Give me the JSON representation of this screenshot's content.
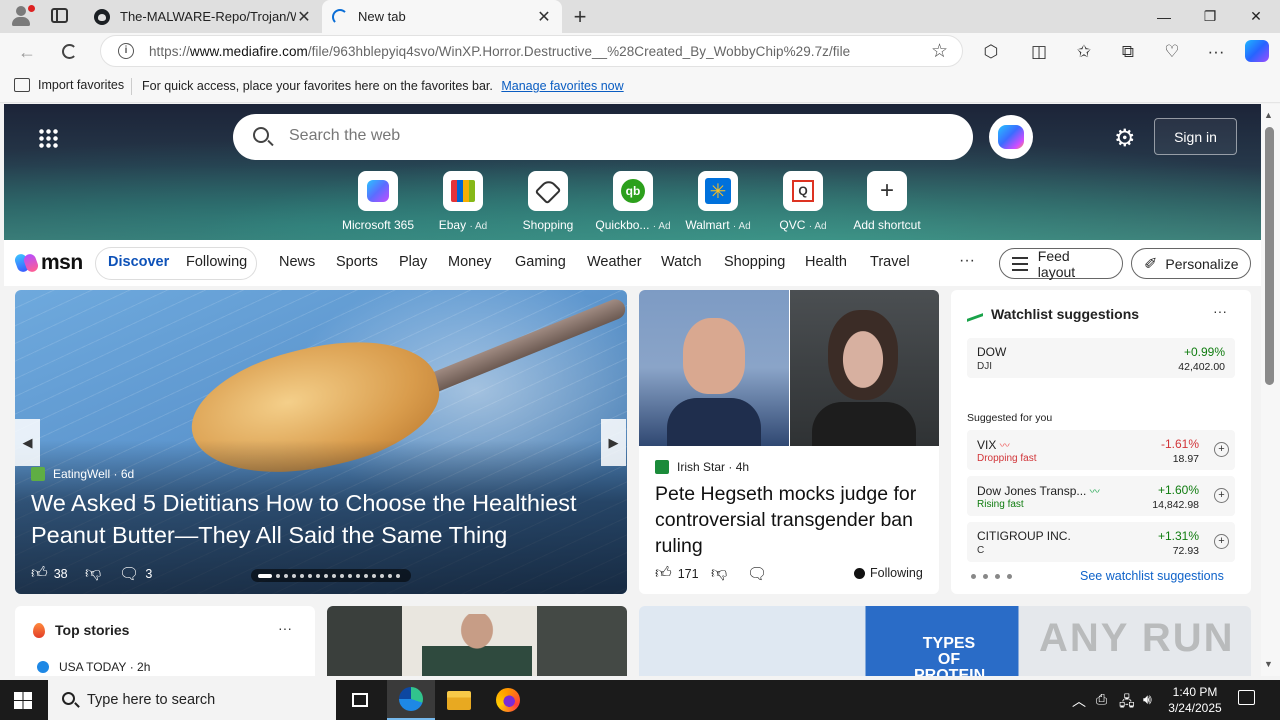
{
  "browser": {
    "tabs": [
      {
        "title": "The-MALWARE-Repo/Trojan/Win"
      },
      {
        "title": "New tab"
      }
    ],
    "url_prefix": "https://",
    "url_host": "www.mediafire.com",
    "url_path": "/file/963hblepyiq4svo/WinXP.Horror.Destructive__%28Created_By_WobbyChip%29.7z/file",
    "favorites_bar": {
      "import_label": "Import favorites",
      "hint": "For quick access, place your favorites here on the favorites bar.",
      "manage_link": "Manage favorites now"
    }
  },
  "msn": {
    "search_placeholder": "Search the web",
    "sign_in": "Sign in",
    "shortcuts": [
      {
        "label": "Microsoft 365",
        "ad": "",
        "icon": "microsoft-365-icon"
      },
      {
        "label": "Ebay",
        "ad": "· Ad",
        "icon": "ebay-icon"
      },
      {
        "label": "Shopping",
        "ad": "",
        "icon": "shopping-tag-icon"
      },
      {
        "label": "Quickbo...",
        "ad": "· Ad",
        "icon": "quickbooks-icon"
      },
      {
        "label": "Walmart",
        "ad": "· Ad",
        "icon": "walmart-icon"
      },
      {
        "label": "QVC",
        "ad": "· Ad",
        "icon": "qvc-icon"
      },
      {
        "label": "Add shortcut",
        "ad": "",
        "icon": "plus-icon"
      }
    ],
    "logo_text": "msn",
    "nav": {
      "discover": "Discover",
      "following": "Following",
      "items": [
        "News",
        "Sports",
        "Play",
        "Money",
        "Gaming",
        "Weather",
        "Watch",
        "Shopping",
        "Health",
        "Travel"
      ],
      "more": "···",
      "feed_layout": "Feed layout",
      "personalize": "Personalize"
    },
    "main_story": {
      "source": "EatingWell",
      "age": "6d",
      "title": "We Asked 5 Dietitians How to Choose the Healthiest Peanut Butter—They All Said the Same Thing",
      "likes": "38",
      "comments": "3"
    },
    "news_story": {
      "source": "Irish Star",
      "age": "4h",
      "title": "Pete Hegseth mocks judge for controversial transgender ban ruling",
      "likes": "171",
      "following": "Following"
    },
    "watchlist": {
      "title": "Watchlist suggestions",
      "featured": {
        "name": "DOW",
        "sub": "DJI",
        "change": "+0.99%",
        "price": "42,402.00"
      },
      "suggested_label": "Suggested for you",
      "items": [
        {
          "name": "VIX",
          "sub": "Dropping fast",
          "change": "-1.61%",
          "price": "18.97",
          "trend": "down"
        },
        {
          "name": "Dow Jones Transp...",
          "sub": "Rising fast",
          "change": "+1.60%",
          "price": "14,842.98",
          "trend": "up"
        },
        {
          "name": "CITIGROUP INC.",
          "sub": "C",
          "change": "+1.31%",
          "price": "72.93",
          "trend": "up"
        }
      ],
      "see_link": "See watchlist suggestions"
    },
    "top_stories": {
      "title": "Top stories",
      "source": "USA TODAY",
      "age": "2h"
    },
    "card3_text": "TYPES OF PROTEIN",
    "watermark": "ANY RUN"
  },
  "taskbar": {
    "search_placeholder": "Type here to search",
    "time": "1:40 PM",
    "date": "3/24/2025"
  }
}
